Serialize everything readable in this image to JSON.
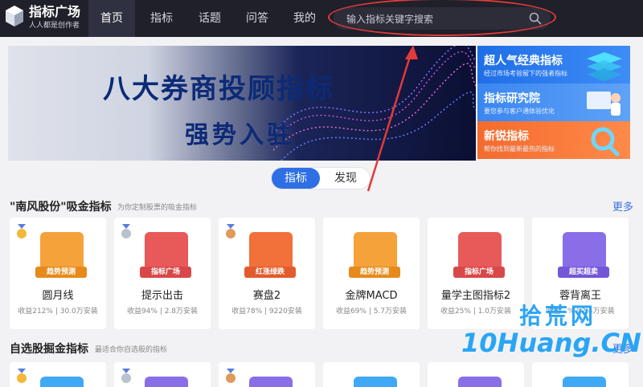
{
  "header": {
    "brand_title": "指标广场",
    "brand_slogan": "人人都是创作者",
    "nav": [
      "首页",
      "指标",
      "话题",
      "问答",
      "我的"
    ],
    "active_nav": "首页",
    "search_placeholder": "输入指标关键字搜索"
  },
  "banner": {
    "title": "八大券商投顾指标",
    "subtitle": "强势入驻"
  },
  "side_cards": [
    {
      "title": "超人气经典指标",
      "subtitle": "经过市场考验留下的强者指标",
      "color": "#1f6ee6"
    },
    {
      "title": "指标研究院",
      "subtitle": "要您参与客户通体验优化",
      "color": "#3a86f0"
    },
    {
      "title": "新锐指标",
      "subtitle": "帮你找到最新最热的指标",
      "color": "#f36b2d"
    }
  ],
  "tabs": {
    "active": "指标",
    "other": "发现"
  },
  "section1": {
    "title": "\"南风股份\"吸金指标",
    "subtitle": "为你定制股票的吸金指标",
    "more": "更多",
    "cards": [
      {
        "name": "圆月线",
        "tag": "趋势预测",
        "stats": "收益212% | 30.0万安装",
        "icon_color": "#f5a23a",
        "tag_color": "#e58a1b",
        "medal": "gold"
      },
      {
        "name": "提示出击",
        "tag": "指标广场",
        "stats": "收益94% | 2.8万安装",
        "icon_color": "#e85a5a",
        "tag_color": "#d84848",
        "medal": "silver"
      },
      {
        "name": "赛盘2",
        "tag": "红涨绿跌",
        "stats": "收益78% | 9220安装",
        "icon_color": "#f2703a",
        "tag_color": "#e35b2c",
        "medal": "bronze"
      },
      {
        "name": "金牌MACD",
        "tag": "趋势预测",
        "stats": "收益69% | 5.7万安装",
        "icon_color": "#f5a23a",
        "tag_color": "#e58a1b",
        "medal": "none"
      },
      {
        "name": "量学主图指标2",
        "tag": "指标广场",
        "stats": "收益25% | 1.0万安装",
        "icon_color": "#e85a5a",
        "tag_color": "#d84848",
        "medal": "none"
      },
      {
        "name": "蓉背离王",
        "tag": "超买超卖",
        "stats": "收益...% | 2.4万安装",
        "icon_color": "#8a6ee8",
        "tag_color": "#7456d8",
        "medal": "none"
      }
    ]
  },
  "section2": {
    "title": "自选股掘金指标",
    "subtitle": "最适合你自选股的指标",
    "more": "更多"
  },
  "watermark": {
    "line1": "拾荒网",
    "line2": "10Huang.CN"
  }
}
